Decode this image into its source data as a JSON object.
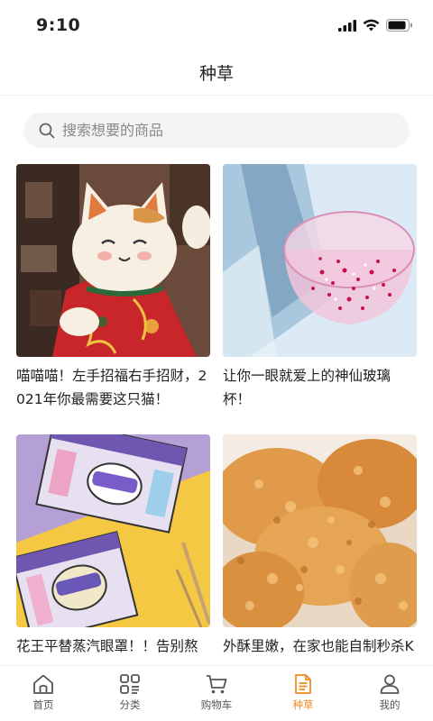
{
  "status_bar": {
    "time": "9:10"
  },
  "nav": {
    "title": "种草"
  },
  "search": {
    "placeholder": "搜索想要的商品"
  },
  "feed": [
    {
      "title": "喵喵喵！左手招福右手招财，2021年你最需要这只猫！"
    },
    {
      "title": "让你一眼就爱上的神仙玻璃杯！"
    },
    {
      "title": "花王平替蒸汽眼罩！！告别熬夜黑眼圈"
    },
    {
      "title": "外酥里嫩，在家也能自制秒杀KFC的香酥鸡块"
    }
  ],
  "tabs": [
    {
      "label": "首页",
      "icon": "home-icon",
      "active": false
    },
    {
      "label": "分类",
      "icon": "category-icon",
      "active": false
    },
    {
      "label": "购物车",
      "icon": "cart-icon",
      "active": false
    },
    {
      "label": "种草",
      "icon": "note-icon",
      "active": true
    },
    {
      "label": "我的",
      "icon": "user-icon",
      "active": false
    }
  ],
  "colors": {
    "accent": "#f08a24",
    "tab_inactive": "#555555",
    "search_bg": "#f4f4f4"
  }
}
